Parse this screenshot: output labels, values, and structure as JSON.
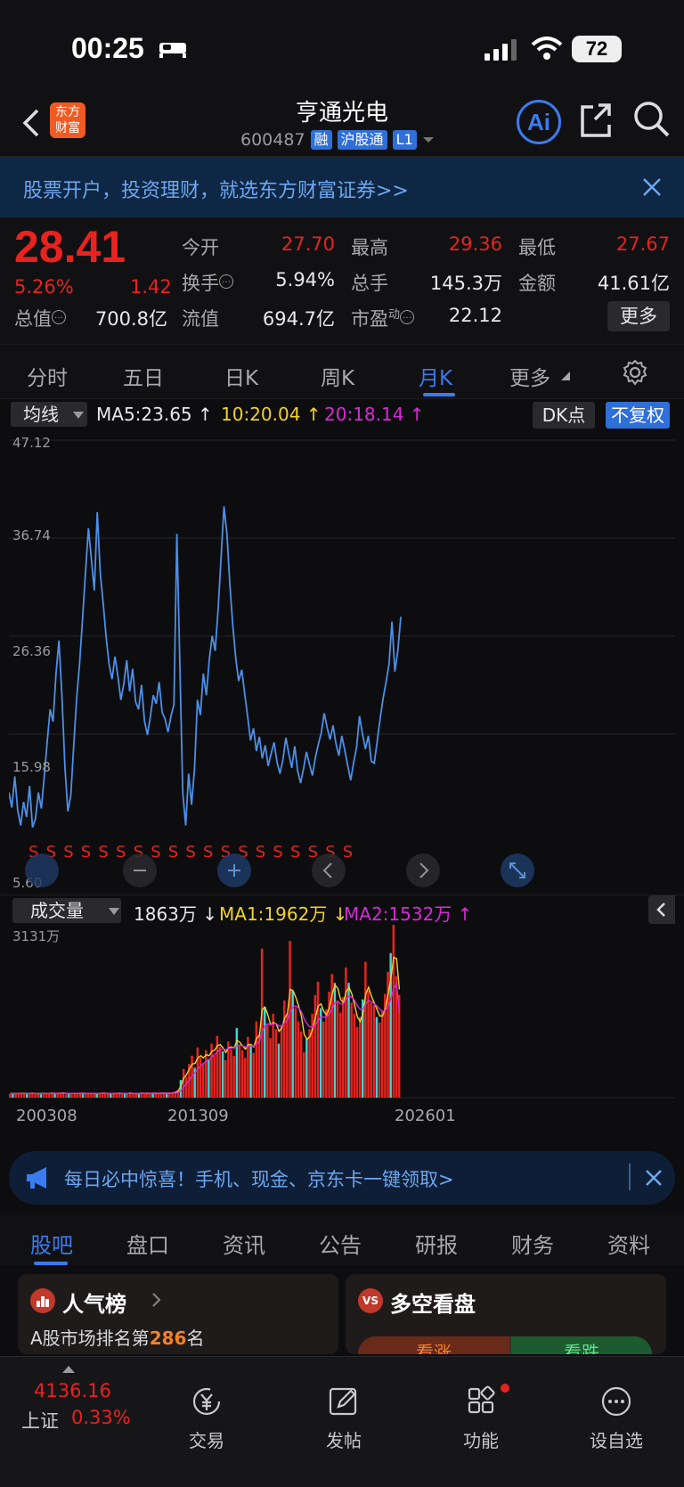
{
  "status_bar": {
    "time": "00:25",
    "battery": "72"
  },
  "header": {
    "logo_text": "东方财富",
    "stock_name": "亨通光电",
    "stock_code": "600487",
    "tags": [
      "融",
      "沪股通",
      "L1"
    ],
    "ai_label": "Ai"
  },
  "ad_banner": {
    "text": "股票开户，投资理财，就选东方财富证券>>"
  },
  "quote": {
    "price": "28.41",
    "change_pct": "5.26%",
    "change": "1.42",
    "fields": [
      {
        "label": "今开",
        "value": "27.70",
        "color": "red"
      },
      {
        "label": "最高",
        "value": "29.36",
        "color": "red"
      },
      {
        "label": "最低",
        "value": "27.67",
        "color": "red"
      },
      {
        "label": "换手",
        "value": "5.94%",
        "color": "white"
      },
      {
        "label": "总手",
        "value": "145.3万",
        "color": "white"
      },
      {
        "label": "金额",
        "value": "41.61亿",
        "color": "white"
      },
      {
        "label": "总值",
        "value": "700.8亿",
        "color": "white"
      },
      {
        "label": "流值",
        "value": "694.7亿",
        "color": "white"
      },
      {
        "label": "市盈",
        "value": "22.12",
        "color": "white"
      }
    ],
    "pe_sup": "动",
    "more_label": "更多"
  },
  "period_tabs": [
    "分时",
    "五日",
    "日K",
    "周K",
    "月K",
    "更多"
  ],
  "active_period": "月K",
  "ma_bar": {
    "select_label": "均线",
    "ma5": "MA5:23.65",
    "ma10": "10:20.04",
    "ma20": "20:18.14",
    "dk_label": "DK点",
    "fq_label": "不复权"
  },
  "colors": {
    "up": "#e8231f",
    "accent": "#3b7bf0",
    "ma10": "#f2d22b",
    "ma20": "#d62bd6",
    "price_line": "#4d8fe6",
    "vol_down": "#39d6d6"
  },
  "chart_data": [
    {
      "type": "line",
      "title": "月K",
      "series": [
        {
          "name": "price",
          "values": [
            9.8,
            8.2,
            11.5,
            7.9,
            6.3,
            8.8,
            7.2,
            10.5,
            6.1,
            7.0,
            9.8,
            8.1,
            11.5,
            15.2,
            18.6,
            17.3,
            22.4,
            25.9,
            20.1,
            12.5,
            7.8,
            9.5,
            14.8,
            19.8,
            23.5,
            28.2,
            33.1,
            37.8,
            34.5,
            31.2,
            39.5,
            33.0,
            29.8,
            26.2,
            23.4,
            21.8,
            24.2,
            22.1,
            19.6,
            21.3,
            23.8,
            20.5,
            22.9,
            19.4,
            18.6,
            21.2,
            17.4,
            15.9,
            17.8,
            20.1,
            19.2,
            21.5,
            18.3,
            17.6,
            16.2,
            17.9,
            19.1,
            37.2,
            23.5,
            9.8,
            6.3,
            11.8,
            8.5,
            12.3,
            19.6,
            18.0,
            22.4,
            20.1,
            23.9,
            26.4,
            24.8,
            29.2,
            34.6,
            40.1,
            37.2,
            31.8,
            27.5,
            24.0,
            21.6,
            22.8,
            20.3,
            17.9,
            15.3,
            16.6,
            14.2,
            15.7,
            13.4,
            14.8,
            12.6,
            13.9,
            15.1,
            13.0,
            11.8,
            13.3,
            15.6,
            13.9,
            12.4,
            14.7,
            12.1,
            10.8,
            12.3,
            14.1,
            12.8,
            11.6,
            13.5,
            14.9,
            16.1,
            18.2,
            16.7,
            15.4,
            16.9,
            15.0,
            13.7,
            15.8,
            14.3,
            12.6,
            11.1,
            13.0,
            14.6,
            17.9,
            16.0,
            14.4,
            15.8,
            13.1,
            12.9,
            15.2,
            17.6,
            19.8,
            21.5,
            23.4,
            27.9,
            22.6,
            24.8,
            28.41
          ]
        }
      ],
      "ylabel_ticks": [
        "47.12",
        "36.74",
        "26.36",
        "15.98",
        "5.60"
      ],
      "ylim": [
        5.6,
        47.12
      ]
    },
    {
      "type": "bar",
      "title": "成交量",
      "label_select": "成交量",
      "vol": "1863万",
      "ma1": "MA1:1962万",
      "ma2": "MA2:1532万",
      "ymax_label": "3131万",
      "ylim": [
        0,
        3131
      ],
      "x_ticks": [
        "200308",
        "201309",
        "202601"
      ],
      "values": [
        70,
        85,
        60,
        75,
        90,
        65,
        80,
        70,
        95,
        60,
        75,
        85,
        70,
        65,
        80,
        90,
        75,
        70,
        85,
        95,
        60,
        70,
        80,
        75,
        65,
        90,
        85,
        70,
        75,
        80,
        65,
        70,
        85,
        90,
        75,
        80,
        70,
        65,
        90,
        85,
        70,
        75,
        80,
        95,
        70,
        65,
        85,
        80,
        75,
        90,
        70,
        85,
        80,
        75,
        90,
        85,
        70,
        80,
        95,
        110,
        140,
        320,
        520,
        380,
        610,
        760,
        540,
        910,
        720,
        620,
        860,
        700,
        980,
        760,
        1120,
        920,
        840,
        680,
        1020,
        880,
        760,
        1260,
        940,
        860,
        720,
        1100,
        930,
        810,
        1380,
        1150,
        2700,
        1650,
        1320,
        1080,
        1520,
        1240,
        980,
        1320,
        1760,
        1520,
        2840,
        1930,
        1620,
        1380,
        1200,
        820,
        1080,
        1240,
        1520,
        1860,
        2100,
        1620,
        1380,
        1600,
        1920,
        2240,
        2080,
        1760,
        1540,
        1820,
        2360,
        2080,
        1720,
        1520,
        1280,
        1460,
        1780,
        2460,
        1940,
        1720,
        1680,
        1460,
        1360,
        1560,
        1880,
        2280,
        2620,
        3131,
        2200,
        1863
      ],
      "ma1_values": [
        75,
        76,
        74,
        76,
        78,
        77,
        78,
        76,
        78,
        75,
        74,
        76,
        77,
        75,
        77,
        80,
        79,
        78,
        80,
        82,
        78,
        76,
        77,
        78,
        76,
        79,
        80,
        78,
        77,
        78,
        74,
        73,
        76,
        80,
        79,
        78,
        76,
        74,
        78,
        80,
        78,
        76,
        77,
        80,
        78,
        75,
        78,
        80,
        79,
        80,
        78,
        80,
        80,
        78,
        80,
        82,
        80,
        80,
        84,
        94,
        120,
        220,
        360,
        420,
        520,
        610,
        620,
        720,
        760,
        720,
        780,
        760,
        840,
        860,
        940,
        960,
        900,
        820,
        900,
        920,
        900,
        1040,
        1000,
        940,
        880,
        960,
        960,
        920,
        1080,
        1120,
        1600,
        1640,
        1500,
        1320,
        1360,
        1340,
        1200,
        1260,
        1440,
        1520,
        1960,
        1940,
        1820,
        1660,
        1480,
        1140,
        1060,
        1100,
        1240,
        1460,
        1660,
        1700,
        1560,
        1500,
        1640,
        1880,
        2040,
        1980,
        1780,
        1720,
        1920,
        2000,
        1880,
        1680,
        1460,
        1380,
        1520,
        1880,
        2000,
        1840,
        1720,
        1600,
        1480,
        1480,
        1620,
        1880,
        2180,
        2540,
        2520,
        1962
      ],
      "ma2_values": [
        72,
        73,
        73,
        74,
        75,
        75,
        76,
        76,
        76,
        75,
        75,
        75,
        76,
        76,
        76,
        77,
        77,
        77,
        78,
        78,
        77,
        77,
        77,
        77,
        77,
        78,
        78,
        78,
        78,
        78,
        77,
        76,
        76,
        77,
        77,
        77,
        77,
        76,
        77,
        77,
        77,
        77,
        77,
        78,
        78,
        77,
        77,
        78,
        78,
        78,
        78,
        79,
        79,
        79,
        79,
        80,
        80,
        80,
        81,
        84,
        94,
        130,
        200,
        250,
        320,
        400,
        450,
        520,
        580,
        620,
        660,
        690,
        740,
        780,
        830,
        870,
        880,
        870,
        890,
        900,
        900,
        940,
        950,
        940,
        920,
        930,
        940,
        930,
        980,
        1020,
        1200,
        1300,
        1340,
        1320,
        1340,
        1340,
        1300,
        1300,
        1360,
        1400,
        1560,
        1640,
        1660,
        1620,
        1560,
        1420,
        1340,
        1280,
        1280,
        1320,
        1400,
        1460,
        1460,
        1460,
        1520,
        1620,
        1720,
        1740,
        1700,
        1700,
        1780,
        1840,
        1820,
        1760,
        1660,
        1600,
        1600,
        1700,
        1760,
        1740,
        1700,
        1660,
        1600,
        1560,
        1580,
        1660,
        1800,
        1980,
        2060,
        1532
      ]
    }
  ],
  "promo": {
    "text": "每日必中惊喜！手机、现金、京东卡一键领取>"
  },
  "section_tabs": [
    "股吧",
    "盘口",
    "资讯",
    "公告",
    "研报",
    "财务",
    "资料"
  ],
  "active_section": "股吧",
  "cards": {
    "popularity": {
      "title": "人气榜",
      "line_prefix": "A股市场排名第",
      "rank": "286",
      "line_suffix": "名"
    },
    "bull_bear": {
      "title": "多空看盘",
      "up_label": "看涨",
      "down_label": "看跌"
    }
  },
  "bottom_nav": {
    "index_value": "4136.16",
    "index_name": "上证",
    "index_pct": "0.33%",
    "items": [
      "交易",
      "发帖",
      "功能",
      "设自选"
    ]
  }
}
